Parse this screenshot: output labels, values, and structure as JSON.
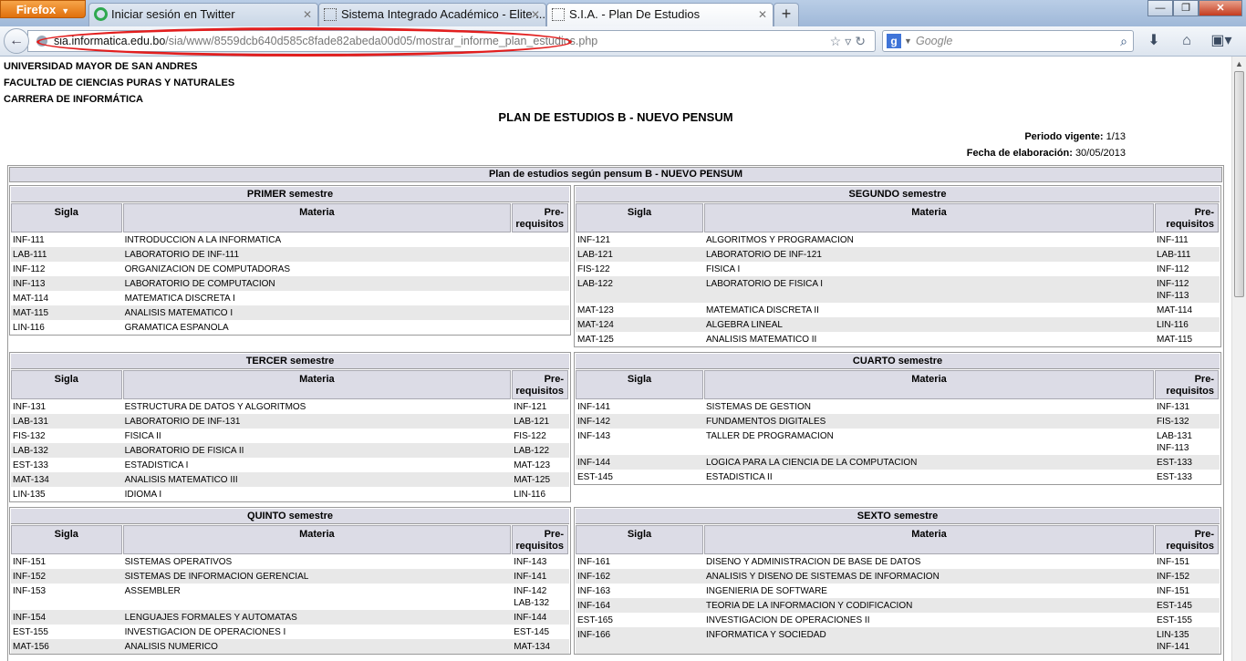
{
  "browser": {
    "app_button": "Firefox",
    "tabs": [
      {
        "label": "Iniciar sesión en Twitter",
        "favicon": "twitter-loading-icon"
      },
      {
        "label": "Sistema Integrado Académico - Elite ...",
        "favicon": "blank-page-icon"
      },
      {
        "label": "S.I.A. - Plan De Estudios",
        "favicon": "blank-page-icon"
      }
    ],
    "new_tab": "+",
    "window_controls": {
      "minimize": "—",
      "maximize": "❐",
      "close": "✕"
    },
    "url": {
      "domain": "sia.informatica.edu.bo",
      "path": "/sia/www/8559dcb640d585c8fade82abeda00d05/mostrar_informe_plan_estudios.php"
    },
    "search_placeholder": "Google",
    "annotation_color": "#e21e1e"
  },
  "page": {
    "university": "UNIVERSIDAD MAYOR DE SAN ANDRES",
    "faculty": "FACULTAD DE CIENCIAS PURAS Y NATURALES",
    "career": "CARRERA DE INFORMÁTICA",
    "title": "PLAN DE ESTUDIOS B - NUEVO PENSUM",
    "period_label": "Periodo vigente:",
    "period_value": "1/13",
    "date_label": "Fecha de elaboración:",
    "date_value": "30/05/2013",
    "plan_header": "Plan de estudios según pensum B - NUEVO PENSUM",
    "columns": {
      "sigla": "Sigla",
      "materia": "Materia",
      "pre_line1": "Pre-",
      "pre_line2": "requisitos"
    },
    "semesters": [
      {
        "title": "PRIMER semestre",
        "rows": [
          {
            "sigla": "INF-111",
            "materia": "INTRODUCCION A LA INFORMATICA",
            "pre": []
          },
          {
            "sigla": "LAB-111",
            "materia": "LABORATORIO DE INF-111",
            "pre": []
          },
          {
            "sigla": "INF-112",
            "materia": "ORGANIZACION DE COMPUTADORAS",
            "pre": []
          },
          {
            "sigla": "INF-113",
            "materia": "LABORATORIO DE COMPUTACION",
            "pre": []
          },
          {
            "sigla": "MAT-114",
            "materia": "MATEMATICA DISCRETA I",
            "pre": []
          },
          {
            "sigla": "MAT-115",
            "materia": "ANALISIS MATEMATICO I",
            "pre": []
          },
          {
            "sigla": "LIN-116",
            "materia": "GRAMATICA ESPANOLA",
            "pre": []
          }
        ]
      },
      {
        "title": "SEGUNDO semestre",
        "rows": [
          {
            "sigla": "INF-121",
            "materia": "ALGORITMOS Y PROGRAMACION",
            "pre": [
              "INF-111"
            ]
          },
          {
            "sigla": "LAB-121",
            "materia": "LABORATORIO DE INF-121",
            "pre": [
              "LAB-111"
            ]
          },
          {
            "sigla": "FIS-122",
            "materia": "FISICA I",
            "pre": [
              "INF-112"
            ]
          },
          {
            "sigla": "LAB-122",
            "materia": "LABORATORIO DE FISICA I",
            "pre": [
              "INF-112",
              "INF-113"
            ]
          },
          {
            "sigla": "MAT-123",
            "materia": "MATEMATICA DISCRETA II",
            "pre": [
              "MAT-114"
            ]
          },
          {
            "sigla": "MAT-124",
            "materia": "ALGEBRA LINEAL",
            "pre": [
              "LIN-116"
            ]
          },
          {
            "sigla": "MAT-125",
            "materia": "ANALISIS MATEMATICO II",
            "pre": [
              "MAT-115"
            ]
          }
        ]
      },
      {
        "title": "TERCER semestre",
        "rows": [
          {
            "sigla": "INF-131",
            "materia": "ESTRUCTURA DE DATOS Y ALGORITMOS",
            "pre": [
              "INF-121"
            ]
          },
          {
            "sigla": "LAB-131",
            "materia": "LABORATORIO DE INF-131",
            "pre": [
              "LAB-121"
            ]
          },
          {
            "sigla": "FIS-132",
            "materia": "FISICA II",
            "pre": [
              "FIS-122"
            ]
          },
          {
            "sigla": "LAB-132",
            "materia": "LABORATORIO DE FISICA II",
            "pre": [
              "LAB-122"
            ]
          },
          {
            "sigla": "EST-133",
            "materia": "ESTADISTICA I",
            "pre": [
              "MAT-123"
            ]
          },
          {
            "sigla": "MAT-134",
            "materia": "ANALISIS MATEMATICO III",
            "pre": [
              "MAT-125"
            ]
          },
          {
            "sigla": "LIN-135",
            "materia": "IDIOMA I",
            "pre": [
              "LIN-116"
            ]
          }
        ]
      },
      {
        "title": "CUARTO semestre",
        "rows": [
          {
            "sigla": "INF-141",
            "materia": "SISTEMAS DE GESTION",
            "pre": [
              "INF-131"
            ]
          },
          {
            "sigla": "INF-142",
            "materia": "FUNDAMENTOS DIGITALES",
            "pre": [
              "FIS-132"
            ]
          },
          {
            "sigla": "INF-143",
            "materia": "TALLER DE PROGRAMACION",
            "pre": [
              "LAB-131",
              "INF-113"
            ]
          },
          {
            "sigla": "INF-144",
            "materia": "LOGICA PARA LA CIENCIA DE LA COMPUTACION",
            "pre": [
              "EST-133"
            ]
          },
          {
            "sigla": "EST-145",
            "materia": "ESTADISTICA II",
            "pre": [
              "EST-133"
            ]
          }
        ]
      },
      {
        "title": "QUINTO semestre",
        "rows": [
          {
            "sigla": "INF-151",
            "materia": "SISTEMAS OPERATIVOS",
            "pre": [
              "INF-143"
            ]
          },
          {
            "sigla": "INF-152",
            "materia": "SISTEMAS DE INFORMACION GERENCIAL",
            "pre": [
              "INF-141"
            ]
          },
          {
            "sigla": "INF-153",
            "materia": "ASSEMBLER",
            "pre": [
              "INF-142",
              "LAB-132"
            ]
          },
          {
            "sigla": "INF-154",
            "materia": "LENGUAJES FORMALES Y AUTOMATAS",
            "pre": [
              "INF-144"
            ]
          },
          {
            "sigla": "EST-155",
            "materia": "INVESTIGACION DE OPERACIONES I",
            "pre": [
              "EST-145"
            ]
          },
          {
            "sigla": "MAT-156",
            "materia": "ANALISIS NUMERICO",
            "pre": [
              "MAT-134"
            ]
          }
        ]
      },
      {
        "title": "SEXTO semestre",
        "rows": [
          {
            "sigla": "INF-161",
            "materia": "DISENO Y ADMINISTRACION DE BASE DE DATOS",
            "pre": [
              "INF-151"
            ]
          },
          {
            "sigla": "INF-162",
            "materia": "ANALISIS Y DISENO DE SISTEMAS DE INFORMACION",
            "pre": [
              "INF-152"
            ]
          },
          {
            "sigla": "INF-163",
            "materia": "INGENIERIA DE SOFTWARE",
            "pre": [
              "INF-151"
            ]
          },
          {
            "sigla": "INF-164",
            "materia": "TEORIA DE LA INFORMACION Y CODIFICACION",
            "pre": [
              "EST-145"
            ]
          },
          {
            "sigla": "EST-165",
            "materia": "INVESTIGACION DE OPERACIONES II",
            "pre": [
              "EST-155"
            ]
          },
          {
            "sigla": "INF-166",
            "materia": "INFORMATICA Y SOCIEDAD",
            "pre": [
              "LIN-135",
              "INF-141"
            ]
          }
        ]
      }
    ]
  }
}
